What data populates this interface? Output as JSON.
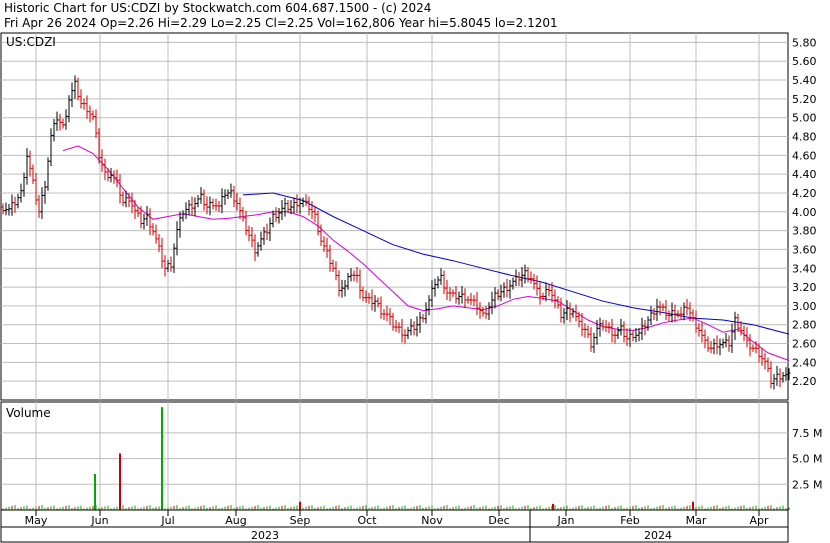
{
  "header": {
    "line1": "Historic Chart for US:CDZI by Stockwatch.com 604.687.1500 - (c) 2024",
    "line2": "Fri Apr 26 2024  Op=2.26  Hi=2.29  Lo=2.25  Cl=2.25  Vol=162,806  Year hi=5.8045  lo=2.1201"
  },
  "chart_data": [
    {
      "type": "ohlc",
      "symbol_label": "US:CDZI",
      "ylim": [
        2.0,
        5.9
      ],
      "y_ticks": [
        "5.80",
        "5.60",
        "5.40",
        "5.20",
        "5.00",
        "4.80",
        "4.60",
        "4.40",
        "4.20",
        "4.00",
        "3.80",
        "3.60",
        "3.40",
        "3.20",
        "3.00",
        "2.80",
        "2.60",
        "2.40",
        "2.20"
      ],
      "x_ticks": [
        "May",
        "Jun",
        "Jul",
        "Aug",
        "Sep",
        "Oct",
        "Nov",
        "Dec",
        "Jan",
        "Feb",
        "Mar",
        "Apr"
      ],
      "year_labels": [
        "2023",
        "2024"
      ],
      "grid": true,
      "colors": {
        "up_bar": "#000000",
        "down_bar": "#cc0000",
        "ma_short": "#d400d4",
        "ma_long": "#0000cc"
      },
      "close_series": [
        [
          0,
          4.05
        ],
        [
          2,
          4.02
        ],
        [
          4,
          4.1
        ],
        [
          6,
          4.2
        ],
        [
          8,
          4.6
        ],
        [
          10,
          4.3
        ],
        [
          12,
          4.0
        ],
        [
          14,
          4.3
        ],
        [
          16,
          4.8
        ],
        [
          18,
          5.0
        ],
        [
          20,
          4.9
        ],
        [
          22,
          5.2
        ],
        [
          24,
          5.35
        ],
        [
          26,
          5.15
        ],
        [
          28,
          5.1
        ],
        [
          30,
          5.0
        ],
        [
          32,
          4.6
        ],
        [
          34,
          4.4
        ],
        [
          36,
          4.4
        ],
        [
          38,
          4.3
        ],
        [
          40,
          4.1
        ],
        [
          42,
          4.15
        ],
        [
          44,
          4.0
        ],
        [
          46,
          3.9
        ],
        [
          48,
          3.95
        ],
        [
          50,
          3.8
        ],
        [
          52,
          3.6
        ],
        [
          54,
          3.4
        ],
        [
          56,
          3.45
        ],
        [
          58,
          3.8
        ],
        [
          60,
          4.0
        ],
        [
          62,
          4.05
        ],
        [
          64,
          4.1
        ],
        [
          66,
          4.15
        ],
        [
          68,
          4.05
        ],
        [
          70,
          4.1
        ],
        [
          72,
          4.05
        ],
        [
          74,
          4.2
        ],
        [
          76,
          4.2
        ],
        [
          78,
          4.1
        ],
        [
          80,
          3.9
        ],
        [
          82,
          3.75
        ],
        [
          84,
          3.6
        ],
        [
          86,
          3.7
        ],
        [
          88,
          3.8
        ],
        [
          90,
          3.95
        ],
        [
          92,
          4.0
        ],
        [
          94,
          4.05
        ],
        [
          96,
          4.05
        ],
        [
          98,
          4.1
        ],
        [
          100,
          4.1
        ],
        [
          102,
          4.05
        ],
        [
          104,
          3.95
        ],
        [
          106,
          3.7
        ],
        [
          108,
          3.55
        ],
        [
          110,
          3.4
        ],
        [
          112,
          3.2
        ],
        [
          114,
          3.2
        ],
        [
          116,
          3.35
        ],
        [
          118,
          3.3
        ],
        [
          120,
          3.1
        ],
        [
          122,
          3.05
        ],
        [
          124,
          3.05
        ],
        [
          126,
          2.95
        ],
        [
          128,
          2.9
        ],
        [
          130,
          2.8
        ],
        [
          132,
          2.75
        ],
        [
          134,
          2.7
        ],
        [
          136,
          2.75
        ],
        [
          138,
          2.8
        ],
        [
          140,
          2.9
        ],
        [
          142,
          3.05
        ],
        [
          144,
          3.25
        ],
        [
          146,
          3.3
        ],
        [
          148,
          3.15
        ],
        [
          150,
          3.1
        ],
        [
          152,
          3.1
        ],
        [
          154,
          3.1
        ],
        [
          156,
          3.05
        ],
        [
          158,
          3.0
        ],
        [
          160,
          2.9
        ],
        [
          162,
          3.0
        ],
        [
          164,
          3.1
        ],
        [
          166,
          3.15
        ],
        [
          168,
          3.2
        ],
        [
          170,
          3.25
        ],
        [
          172,
          3.3
        ],
        [
          174,
          3.35
        ],
        [
          176,
          3.3
        ],
        [
          178,
          3.15
        ],
        [
          180,
          3.1
        ],
        [
          182,
          3.2
        ],
        [
          184,
          3.05
        ],
        [
          186,
          2.9
        ],
        [
          188,
          2.95
        ],
        [
          190,
          2.95
        ],
        [
          192,
          2.8
        ],
        [
          194,
          2.75
        ],
        [
          196,
          2.6
        ],
        [
          198,
          2.75
        ],
        [
          200,
          2.8
        ],
        [
          202,
          2.75
        ],
        [
          204,
          2.7
        ],
        [
          206,
          2.75
        ],
        [
          208,
          2.65
        ],
        [
          210,
          2.7
        ],
        [
          212,
          2.7
        ],
        [
          214,
          2.8
        ],
        [
          216,
          2.9
        ],
        [
          218,
          3.0
        ],
        [
          220,
          2.95
        ],
        [
          222,
          2.9
        ],
        [
          224,
          2.95
        ],
        [
          226,
          2.9
        ],
        [
          228,
          3.0
        ],
        [
          230,
          2.85
        ],
        [
          232,
          2.75
        ],
        [
          234,
          2.6
        ],
        [
          236,
          2.55
        ],
        [
          238,
          2.6
        ],
        [
          240,
          2.6
        ],
        [
          242,
          2.6
        ],
        [
          244,
          2.85
        ],
        [
          246,
          2.75
        ],
        [
          248,
          2.6
        ],
        [
          250,
          2.55
        ],
        [
          252,
          2.5
        ],
        [
          254,
          2.4
        ],
        [
          256,
          2.2
        ],
        [
          258,
          2.25
        ],
        [
          260,
          2.27
        ],
        [
          262,
          2.25
        ]
      ],
      "ma_short": [
        [
          20,
          4.65
        ],
        [
          25,
          4.7
        ],
        [
          30,
          4.62
        ],
        [
          35,
          4.45
        ],
        [
          40,
          4.25
        ],
        [
          45,
          4.05
        ],
        [
          50,
          3.92
        ],
        [
          55,
          3.95
        ],
        [
          60,
          3.98
        ],
        [
          65,
          3.95
        ],
        [
          70,
          3.92
        ],
        [
          75,
          3.93
        ],
        [
          80,
          3.95
        ],
        [
          85,
          3.97
        ],
        [
          90,
          4.0
        ],
        [
          95,
          4.0
        ],
        [
          100,
          3.95
        ],
        [
          105,
          3.85
        ],
        [
          110,
          3.7
        ],
        [
          115,
          3.58
        ],
        [
          120,
          3.45
        ],
        [
          125,
          3.3
        ],
        [
          130,
          3.15
        ],
        [
          135,
          3.0
        ],
        [
          140,
          2.95
        ],
        [
          145,
          2.97
        ],
        [
          150,
          3.0
        ],
        [
          155,
          2.98
        ],
        [
          160,
          2.96
        ],
        [
          165,
          3.0
        ],
        [
          170,
          3.07
        ],
        [
          175,
          3.1
        ],
        [
          180,
          3.08
        ],
        [
          185,
          3.05
        ],
        [
          190,
          2.95
        ],
        [
          195,
          2.85
        ],
        [
          200,
          2.78
        ],
        [
          205,
          2.75
        ],
        [
          210,
          2.74
        ],
        [
          215,
          2.77
        ],
        [
          220,
          2.82
        ],
        [
          225,
          2.85
        ],
        [
          230,
          2.87
        ],
        [
          235,
          2.8
        ],
        [
          240,
          2.72
        ],
        [
          245,
          2.75
        ],
        [
          250,
          2.62
        ],
        [
          255,
          2.5
        ],
        [
          262,
          2.42
        ]
      ],
      "ma_long": [
        [
          80,
          4.18
        ],
        [
          90,
          4.2
        ],
        [
          100,
          4.12
        ],
        [
          110,
          3.95
        ],
        [
          120,
          3.8
        ],
        [
          130,
          3.65
        ],
        [
          140,
          3.55
        ],
        [
          150,
          3.48
        ],
        [
          160,
          3.4
        ],
        [
          170,
          3.32
        ],
        [
          180,
          3.25
        ],
        [
          190,
          3.15
        ],
        [
          200,
          3.05
        ],
        [
          210,
          2.98
        ],
        [
          220,
          2.93
        ],
        [
          230,
          2.87
        ],
        [
          240,
          2.85
        ],
        [
          250,
          2.8
        ],
        [
          262,
          2.7
        ]
      ]
    },
    {
      "type": "bar",
      "title": "Volume",
      "ylim": [
        0,
        10.5
      ],
      "y_ticks": [
        "7.5 M",
        "5.0 M",
        "2.5 M"
      ],
      "spikes": [
        [
          95,
          3.5,
          "#00aa00"
        ],
        [
          120,
          5.5,
          "#cc0000"
        ],
        [
          162,
          10.0,
          "#00aa00"
        ],
        [
          300,
          0.8,
          "#cc0000"
        ],
        [
          553,
          0.6,
          "#cc0000"
        ],
        [
          693,
          0.8,
          "#cc0000"
        ]
      ]
    }
  ]
}
